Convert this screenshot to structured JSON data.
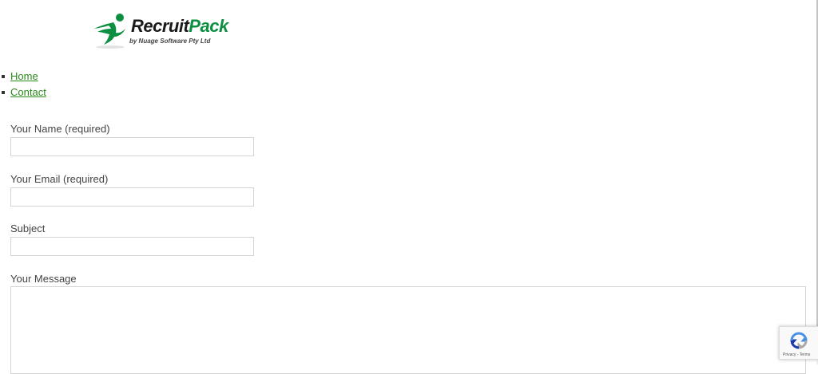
{
  "logo": {
    "name_part1": "Recruit",
    "name_part2": "Pack",
    "tagline": "by Nuage Software Pty Ltd",
    "icon": "running-figure-icon",
    "colors": {
      "green": "#0d8f42",
      "dark": "#1a1a1a"
    }
  },
  "nav": {
    "items": [
      {
        "label": "Home"
      },
      {
        "label": "Contact"
      }
    ],
    "link_color": "#2a8a1a"
  },
  "form": {
    "name_label": "Your Name (required)",
    "name_value": "",
    "email_label": "Your Email (required)",
    "email_value": "",
    "subject_label": "Subject",
    "subject_value": "",
    "message_label": "Your Message",
    "message_value": ""
  },
  "recaptcha": {
    "icon": "recaptcha-icon",
    "links": "Privacy - Terms"
  }
}
